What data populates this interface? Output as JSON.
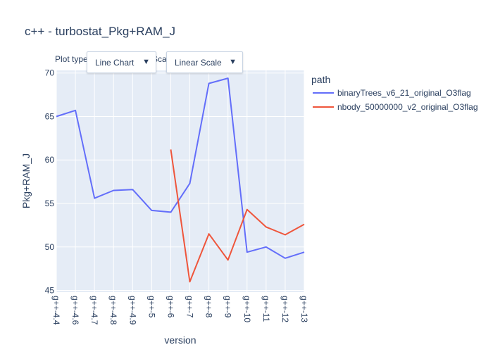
{
  "chart_data": {
    "type": "line",
    "title": "c++ - turbostat_Pkg+RAM_J",
    "xlabel": "version",
    "ylabel": "Pkg+RAM_J",
    "categories": [
      "g++-4.4",
      "g++-4.6",
      "g++-4.7",
      "g++-4.8",
      "g++-4.9",
      "g++-5",
      "g++-6",
      "g++-7",
      "g++-8",
      "g++-9",
      "g++-10",
      "g++-11",
      "g++-12",
      "g++-13"
    ],
    "ylim": [
      44.8,
      70.3
    ],
    "yticks": [
      45,
      50,
      55,
      60,
      65,
      70
    ],
    "legend_title": "path",
    "legend_position": "right",
    "grid": true,
    "series": [
      {
        "name": "binaryTrees_v6_21_original_O3flag",
        "color": "#636efa",
        "values": [
          65.0,
          65.7,
          55.6,
          56.5,
          56.6,
          54.2,
          54.0,
          57.3,
          68.8,
          69.4,
          49.4,
          50.0,
          48.7,
          49.4
        ]
      },
      {
        "name": "nbody_50000000_v2_original_O3flag",
        "color": "#ef553b",
        "values": [
          null,
          null,
          null,
          null,
          null,
          null,
          61.2,
          46.0,
          51.5,
          48.5,
          54.3,
          52.3,
          51.4,
          52.6
        ]
      }
    ]
  },
  "controls": {
    "plot_type_label": "Plot type:",
    "scale_label": "Scale:",
    "chart_type_value": "Line Chart",
    "scale_value": "Linear Scale"
  }
}
